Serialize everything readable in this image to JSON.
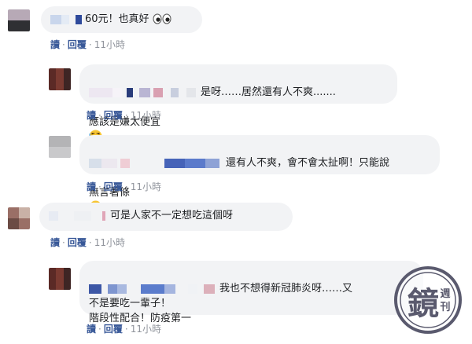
{
  "comments": [
    {
      "id": "c1",
      "text": "60元！也真好",
      "action_read": "讀",
      "action_reply": "回覆",
      "time": "11小時"
    },
    {
      "id": "c2",
      "text_line1": "是呀……居然還有人不爽.......",
      "text_line2": "應該是嫌太便宜",
      "action_read": "讀",
      "action_reply": "回覆",
      "time": "11小時"
    },
    {
      "id": "c3",
      "text_line1": "還有人不爽，會不會太扯啊！只能說",
      "text_line2": "無言著條",
      "action_read": "讀",
      "action_reply": "回覆",
      "time": "11小時"
    },
    {
      "id": "c4",
      "text": "可是人家不一定想吃這個呀",
      "action_read": "讀",
      "action_reply": "回覆",
      "time": "11小時"
    },
    {
      "id": "c5",
      "text_line1": "我也不想得新冠肺炎呀……又",
      "text_line2": "不是要吃一輩子！",
      "text_line3": "階段性配合！防疫第一",
      "action_read": "讀",
      "action_reply": "回覆",
      "time": "11小時"
    }
  ],
  "separator": "·",
  "icons": {
    "eyes": "eyes-emoji-icon",
    "laugh": "laughing-emoji-icon",
    "thinking": "thinking-emoji-icon"
  },
  "colors": {
    "bubble": "#f2f3f5",
    "link": "#385898",
    "meta": "#90949c",
    "watermark": "#5a5a6e"
  },
  "watermark": {
    "text": "鏡",
    "small_top": "週",
    "small_bottom": "刊"
  }
}
